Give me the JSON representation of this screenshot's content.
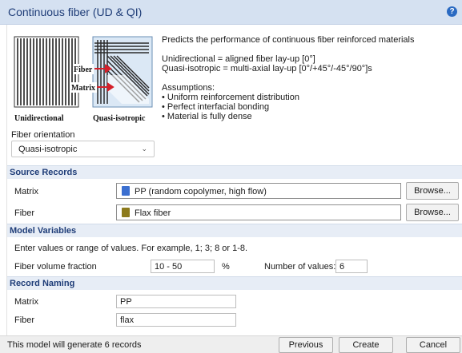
{
  "window": {
    "title": "Continuous fiber (UD & QI)",
    "help_icon": "help-icon",
    "accent": "#1f3d78"
  },
  "diagram": {
    "label_fiber": "Fiber",
    "label_matrix": "Matrix",
    "caption_left": "Unidirectional",
    "caption_right": "Quasi-isotropic"
  },
  "description": {
    "line1": "Predicts the performance of continuous fiber reinforced materials",
    "line2": "Unidirectional = aligned fiber lay-up [0°]",
    "line3": "Quasi-isotropic = multi-axial lay-up [0°/+45°/-45°/90°]s",
    "heading": "Assumptions:",
    "bullet1": "• Uniform reinforcement distribution",
    "bullet2": "• Perfect interfacial bonding",
    "bullet3": "• Material is fully dense"
  },
  "orientation": {
    "label": "Fiber orientation",
    "value": "Quasi-isotropic"
  },
  "source_records": {
    "heading": "Source Records",
    "matrix_label": "Matrix",
    "matrix_value": "PP (random copolymer, high flow)",
    "fiber_label": "Fiber",
    "fiber_value": "Flax fiber",
    "browse_label": "Browse..."
  },
  "model_variables": {
    "heading": "Model Variables",
    "hint": "Enter values or range of values. For example, 1; 3; 8 or 1-8.",
    "vf_label": "Fiber volume fraction",
    "vf_value": "10 - 50",
    "vf_unit": "%",
    "nvalues_label": "Number of values:",
    "nvalues_value": "6"
  },
  "record_naming": {
    "heading": "Record Naming",
    "matrix_label": "Matrix",
    "matrix_value": "PP",
    "fiber_label": "Fiber",
    "fiber_value": "flax"
  },
  "footer": {
    "status": "This model will generate 6 records",
    "previous": "Previous",
    "create": "Create",
    "cancel": "Cancel"
  }
}
